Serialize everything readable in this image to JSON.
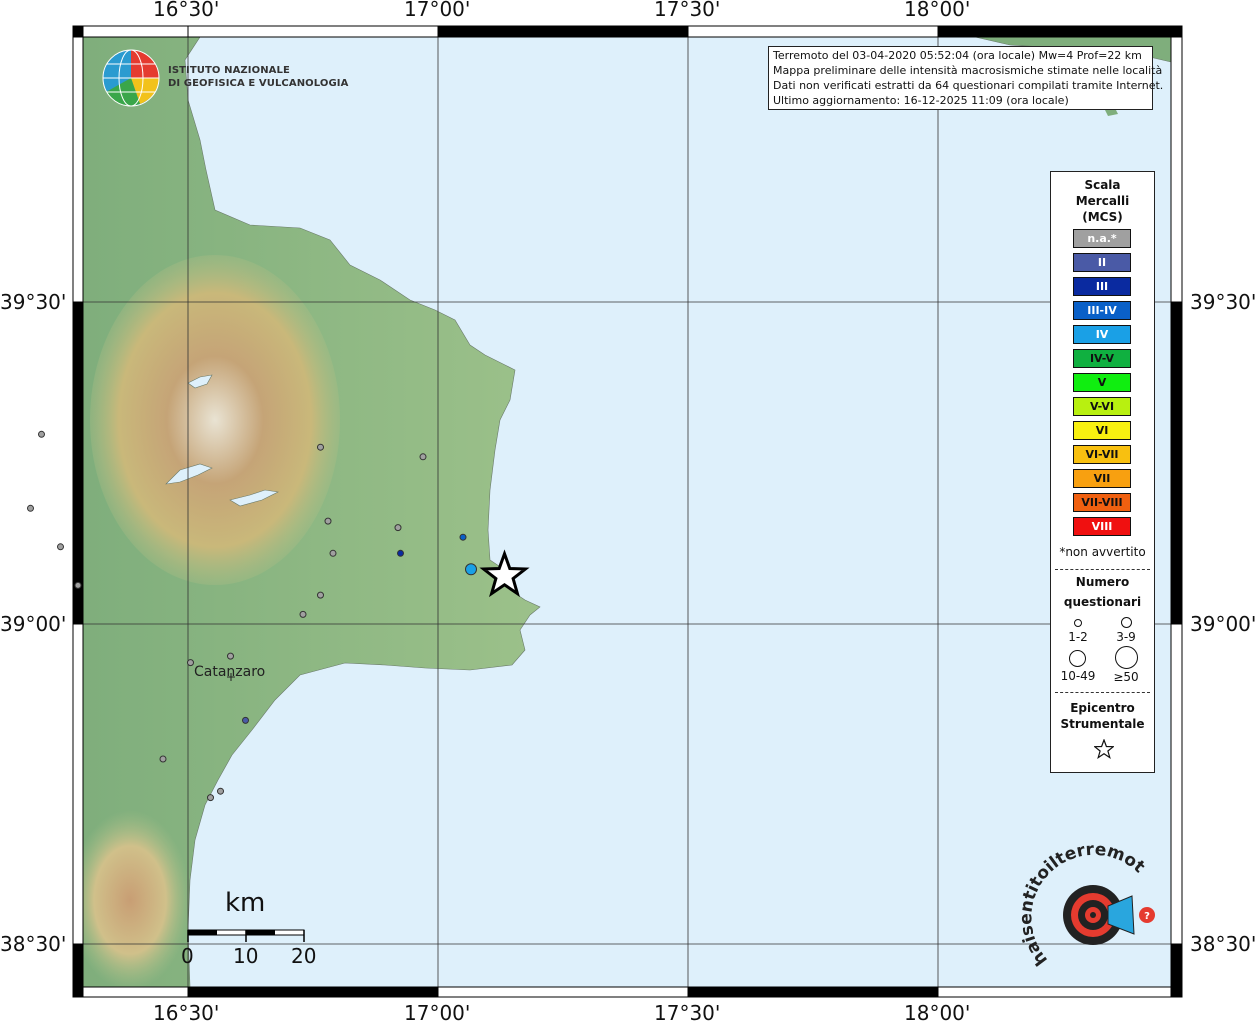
{
  "info_box": {
    "line1": "Terremoto del 03-04-2020 05:52:04 (ora locale) Mw=4 Prof=22 km",
    "line2": "Mappa preliminare delle intensità macrosismiche stimate nelle località",
    "line3": "Dati non verificati estratti da 64 questionari compilati tramite Internet.",
    "line4": "Ultimo aggiornamento: 16-12-2025 11:09 (ora locale)"
  },
  "logo": {
    "line1": "ISTITUTO NAZIONALE",
    "line2": "DI GEOFISICA E VULCANOLOGIA"
  },
  "axes": {
    "lon_labels": [
      "16°30'",
      "17°00'",
      "17°30'",
      "18°00'"
    ],
    "lat_labels": [
      "39°30'",
      "39°00'",
      "38°30'"
    ]
  },
  "legend": {
    "title1": "Scala",
    "title2": "Mercalli",
    "title3": "(MCS)",
    "scale": [
      {
        "label": "n.a.*",
        "color": "#a0a0a0",
        "text": "#ffffff"
      },
      {
        "label": "II",
        "color": "#4a5aa6",
        "text": "#ffffff"
      },
      {
        "label": "III",
        "color": "#0a2aa0",
        "text": "#ffffff"
      },
      {
        "label": "III-IV",
        "color": "#0a60c8",
        "text": "#ffffff"
      },
      {
        "label": "IV",
        "color": "#1aa0e6",
        "text": "#ffffff"
      },
      {
        "label": "IV-V",
        "color": "#10b040",
        "text": "#111111"
      },
      {
        "label": "V",
        "color": "#10ee10",
        "text": "#111111"
      },
      {
        "label": "V-VI",
        "color": "#b8f010",
        "text": "#111111"
      },
      {
        "label": "VI",
        "color": "#f8f010",
        "text": "#111111"
      },
      {
        "label": "VI-VII",
        "color": "#f8c010",
        "text": "#111111"
      },
      {
        "label": "VII",
        "color": "#f8a010",
        "text": "#111111"
      },
      {
        "label": "VII-VIII",
        "color": "#f06010",
        "text": "#111111"
      },
      {
        "label": "VIII",
        "color": "#f01010",
        "text": "#ffffff"
      }
    ],
    "not_felt_note": "*non avvertito",
    "count_title1": "Numero",
    "count_title2": "questionari",
    "count_labels": [
      "1-2",
      "3-9",
      "10-49",
      "≥50"
    ],
    "epicenter_title1": "Epicentro",
    "epicenter_title2": "Strumentale"
  },
  "places": {
    "catanzaro": "Catanzaro"
  },
  "scalebar": {
    "unit": "km",
    "ticks": [
      "0",
      "10",
      "20"
    ]
  },
  "observations": [
    {
      "lon": 17.066,
      "lat": 39.085,
      "intensity": "IV",
      "count": "3-9",
      "color": "#1aa0e6"
    },
    {
      "lon": 16.925,
      "lat": 39.11,
      "intensity": "III",
      "count": "1-2",
      "color": "#0a2aa0"
    },
    {
      "lon": 17.05,
      "lat": 39.135,
      "intensity": "III-IV",
      "count": "1-2",
      "color": "#0a60c8"
    },
    {
      "lon": 16.615,
      "lat": 38.85,
      "intensity": "II",
      "count": "1-2",
      "color": "#4a5aa6"
    },
    {
      "lon": 16.207,
      "lat": 39.295,
      "intensity": "n.a.*",
      "count": "1-2",
      "color": "#a0a0a0"
    },
    {
      "lon": 16.185,
      "lat": 39.18,
      "intensity": "n.a.*",
      "count": "1-2",
      "color": "#a0a0a0"
    },
    {
      "lon": 16.245,
      "lat": 39.12,
      "intensity": "n.a.*",
      "count": "1-2",
      "color": "#a0a0a0"
    },
    {
      "lon": 16.28,
      "lat": 39.06,
      "intensity": "n.a.*",
      "count": "1-2",
      "color": "#a0a0a0"
    },
    {
      "lon": 16.765,
      "lat": 39.275,
      "intensity": "n.a.*",
      "count": "1-2",
      "color": "#a0a0a0"
    },
    {
      "lon": 16.97,
      "lat": 39.26,
      "intensity": "n.a.*",
      "count": "1-2",
      "color": "#a0a0a0"
    },
    {
      "lon": 16.78,
      "lat": 39.16,
      "intensity": "n.a.*",
      "count": "1-2",
      "color": "#a0a0a0"
    },
    {
      "lon": 16.92,
      "lat": 39.15,
      "intensity": "n.a.*",
      "count": "1-2",
      "color": "#a0a0a0"
    },
    {
      "lon": 16.79,
      "lat": 39.11,
      "intensity": "n.a.*",
      "count": "1-2",
      "color": "#a0a0a0"
    },
    {
      "lon": 16.765,
      "lat": 39.045,
      "intensity": "n.a.*",
      "count": "1-2",
      "color": "#a0a0a0"
    },
    {
      "lon": 16.73,
      "lat": 39.015,
      "intensity": "n.a.*",
      "count": "1-2",
      "color": "#a0a0a0"
    },
    {
      "lon": 16.505,
      "lat": 38.94,
      "intensity": "n.a.*",
      "count": "1-2",
      "color": "#a0a0a0"
    },
    {
      "lon": 16.585,
      "lat": 38.95,
      "intensity": "n.a.*",
      "count": "1-2",
      "color": "#a0a0a0"
    },
    {
      "lon": 16.45,
      "lat": 38.79,
      "intensity": "n.a.*",
      "count": "1-2",
      "color": "#a0a0a0"
    },
    {
      "lon": 16.565,
      "lat": 38.74,
      "intensity": "n.a.*",
      "count": "1-2",
      "color": "#a0a0a0"
    },
    {
      "lon": 16.545,
      "lat": 38.73,
      "intensity": "n.a.*",
      "count": "1-2",
      "color": "#a0a0a0"
    }
  ],
  "epicenter": {
    "lon": 17.133,
    "lat": 39.075
  },
  "colors": {
    "sea": "#def0fb",
    "grid": "#333333",
    "frame": "#000000"
  }
}
